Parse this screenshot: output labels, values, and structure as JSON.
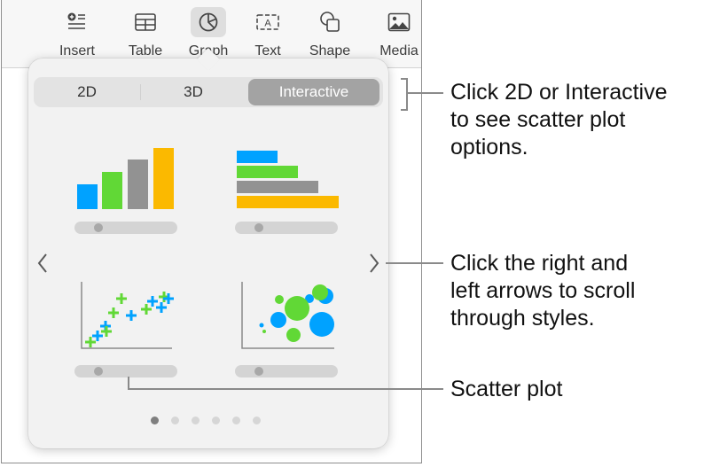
{
  "toolbar": {
    "items": [
      {
        "label": "Insert",
        "icon": "insert-icon",
        "active": false
      },
      {
        "label": "Table",
        "icon": "table-icon",
        "active": false
      },
      {
        "label": "Graph",
        "icon": "chart-icon",
        "active": true
      },
      {
        "label": "Text",
        "icon": "text-box-icon",
        "active": false
      },
      {
        "label": "Shape",
        "icon": "shape-icon",
        "active": false
      },
      {
        "label": "Media",
        "icon": "media-icon",
        "active": false
      }
    ]
  },
  "popover": {
    "segments": [
      {
        "label": "2D",
        "selected": false
      },
      {
        "label": "3D",
        "selected": false
      },
      {
        "label": "Interactive",
        "selected": true
      }
    ],
    "charts": [
      {
        "name": "column-chart",
        "type": "column"
      },
      {
        "name": "bar-chart",
        "type": "bar"
      },
      {
        "name": "scatter-chart",
        "type": "scatter"
      },
      {
        "name": "bubble-chart",
        "type": "bubble"
      }
    ],
    "colors": {
      "blue": "#00a2ff",
      "green": "#61d836",
      "gray": "#929292",
      "yellow": "#fbb900"
    },
    "prev_icon": "chevron-left-icon",
    "next_icon": "chevron-right-icon",
    "page_count": 6,
    "current_page": 1
  },
  "callouts": {
    "segment_note": "Click 2D or Interactive to see scatter plot options.",
    "segment_lines": [
      "Click 2D or Interactive",
      "to see scatter plot",
      "options."
    ],
    "arrows_lines": [
      "Click the right and",
      "left arrows to scroll",
      "through styles."
    ],
    "scatter_label": "Scatter plot"
  }
}
